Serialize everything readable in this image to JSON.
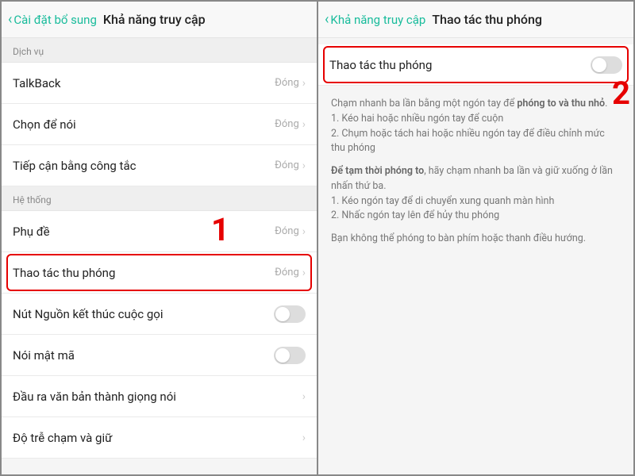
{
  "left": {
    "back": "Cài đặt bổ sung",
    "title": "Khả năng truy cập",
    "section1": "Dịch vụ",
    "rows1": [
      {
        "label": "TalkBack",
        "status": "Đóng"
      },
      {
        "label": "Chọn để nói",
        "status": "Đóng"
      },
      {
        "label": "Tiếp cận bằng công tắc",
        "status": "Đóng"
      }
    ],
    "section2": "Hệ thống",
    "rows2": [
      {
        "label": "Phụ đề",
        "status": "Đóng",
        "type": "link"
      },
      {
        "label": "Thao tác thu phóng",
        "status": "Đóng",
        "type": "link",
        "highlight": true
      },
      {
        "label": "Nút Nguồn kết thúc cuộc gọi",
        "type": "toggle"
      },
      {
        "label": "Nói mật mã",
        "type": "toggle"
      },
      {
        "label": "Đầu ra văn bản thành giọng nói",
        "type": "link"
      },
      {
        "label": "Độ trễ chạm và giữ",
        "type": "link"
      }
    ]
  },
  "right": {
    "back": "Khả năng truy cập",
    "title": "Thao tác thu phóng",
    "toggle_label": "Thao tác thu phóng",
    "para1_a": "Chạm nhanh ba lần bằng một ngón tay để ",
    "para1_b": "phóng to và thu nhỏ",
    "para1_c": ".",
    "bullet1": "1. Kéo hai hoặc nhiều ngón tay để cuộn",
    "bullet2": "2. Chụm hoặc tách hai hoặc nhiều ngón tay để điều chỉnh mức thu phóng",
    "para2_a": "Để tạm thời phóng to",
    "para2_b": ", hãy chạm nhanh ba lần và giữ xuống ở lần nhấn thứ ba.",
    "bullet3": "1. Kéo ngón tay để di chuyển xung quanh màn hình",
    "bullet4": "2. Nhấc ngón tay lên để hủy thu phóng",
    "para3": "Bạn không thể phóng to bàn phím hoặc thanh điều hướng."
  },
  "callouts": {
    "one": "1",
    "two": "2"
  }
}
